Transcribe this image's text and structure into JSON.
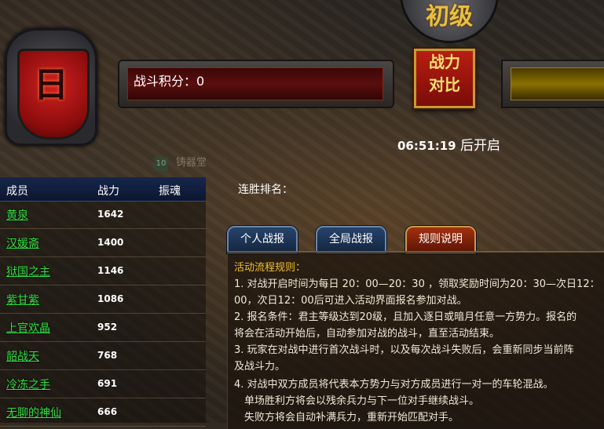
{
  "top_title": "初级",
  "faction_char": "日",
  "score_label": "战斗积分：0",
  "compare_button": [
    "战力",
    "对比"
  ],
  "timer": {
    "time": "06:51:19",
    "suffix": "后开启"
  },
  "background_text": {
    "number": "10",
    "label": "铸器堂"
  },
  "member_table": {
    "headers": [
      "成员",
      "战力",
      "振魂"
    ],
    "rows": [
      {
        "name": "黄泉",
        "power": "1642"
      },
      {
        "name": "汉媛斋",
        "power": "1400"
      },
      {
        "name": "狱国之主",
        "power": "1146"
      },
      {
        "name": "紫甘紫",
        "power": "1086"
      },
      {
        "name": "上官欢晶",
        "power": "952"
      },
      {
        "name": "韶战天",
        "power": "768"
      },
      {
        "name": "冷冻之手",
        "power": "691"
      },
      {
        "name": "无聊的神仙",
        "power": "666"
      }
    ]
  },
  "streak_label": "连胜排名：",
  "tabs": [
    "个人战报",
    "全局战报",
    "规则说明"
  ],
  "active_tab": 2,
  "rules": [
    "活动流程规则：",
    "1. 对战开启时间为每日 20：00—20：30 ，领取奖励时间为20：30—次日12：",
    "00，次日12：00后可进入活动界面报名参加对战。",
    "2. 报名条件：君主等级达到20级，且加入逐日或暗月任意一方势力。报名的",
    "将会在活动开始后，自动参加对战的战斗，直至活动结束。",
    "3. 玩家在对战中进行首次战斗时，以及每次战斗失败后，会重新同步当前阵",
    "及战斗力。",
    "4. 对战中双方成员将代表本方势力与对方成员进行一对一的车轮混战。",
    "　单场胜利方将会以残余兵力与下一位对手继续战斗。",
    "　失败方将会自动补满兵力，重新开始匹配对手。"
  ],
  "colors": {
    "member_name": "#30e040",
    "rule_heading": "#f0c030",
    "active_tab": "#a23010"
  }
}
